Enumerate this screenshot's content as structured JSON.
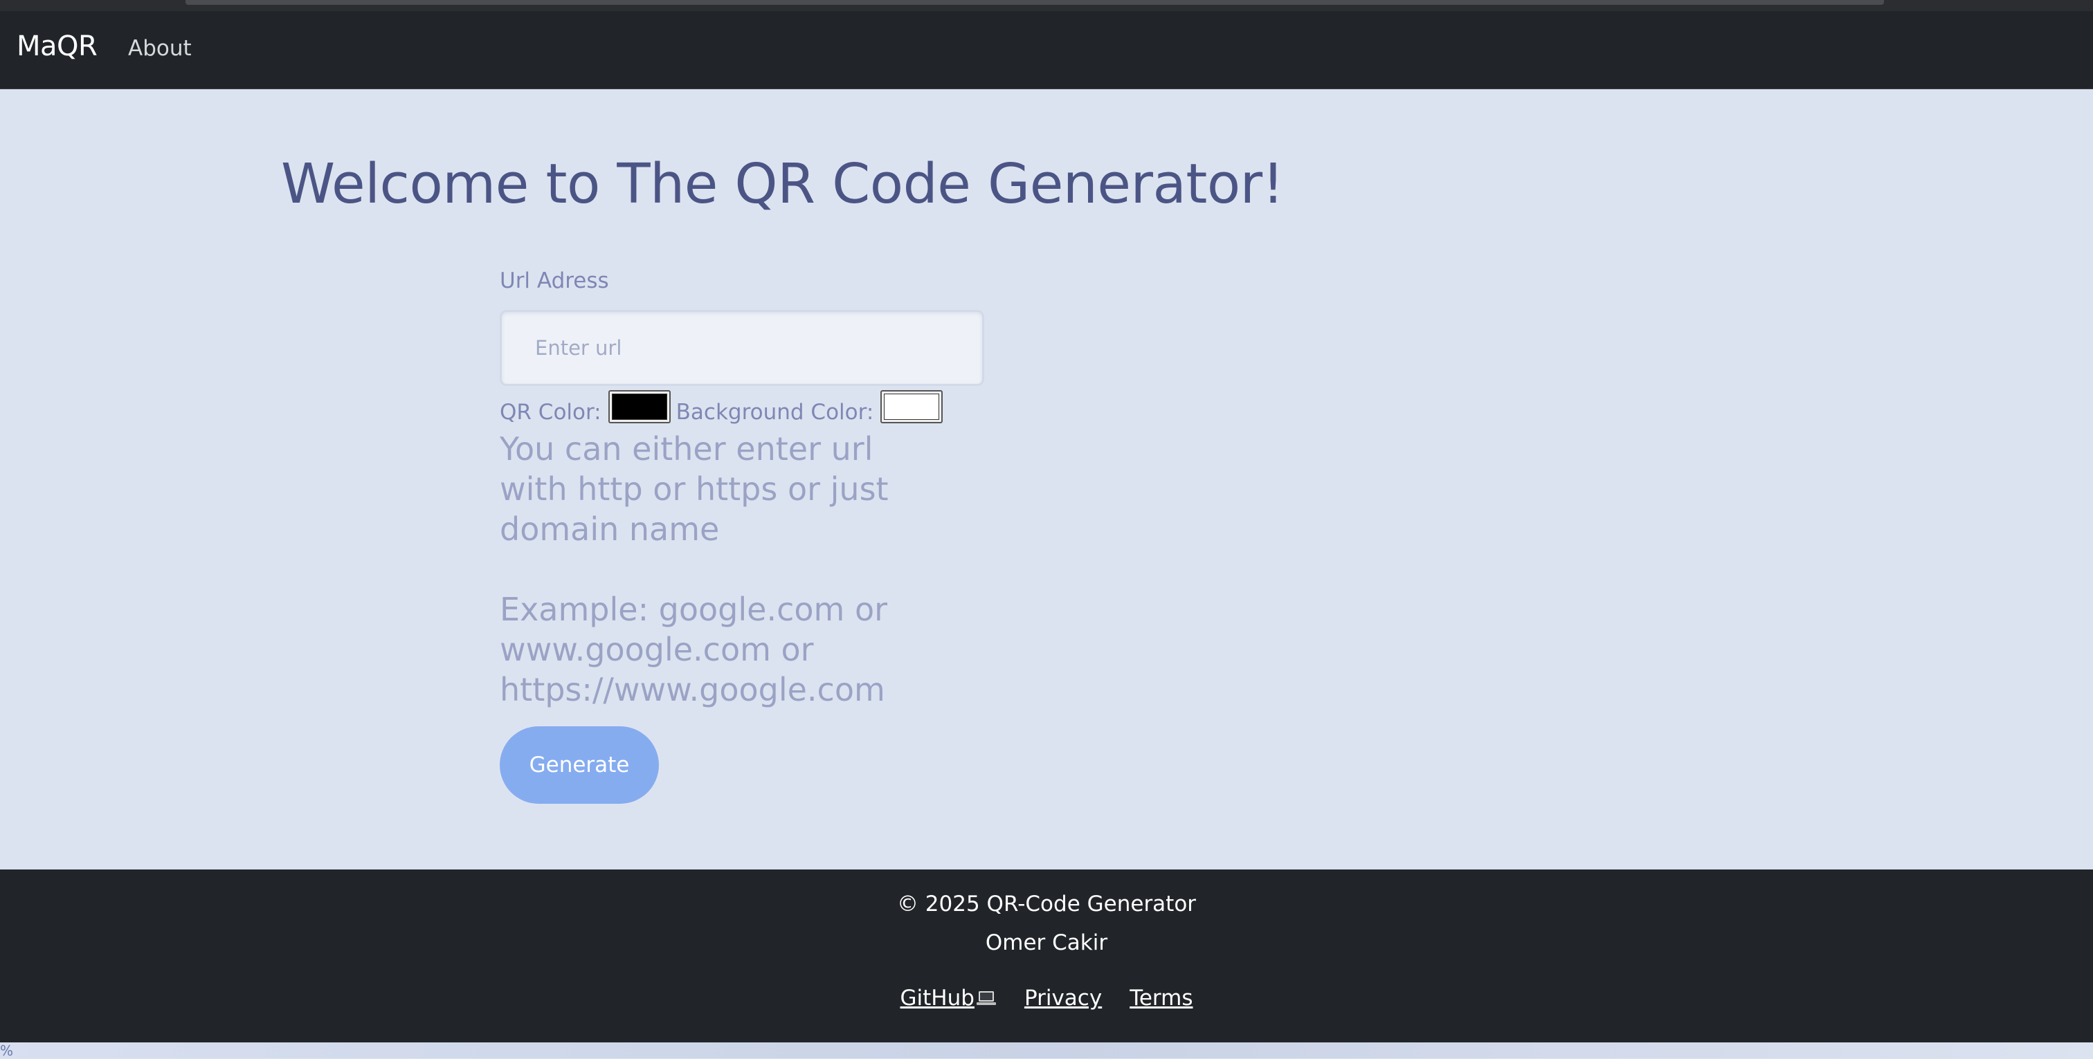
{
  "navbar": {
    "brand": "MaQR",
    "links": [
      "About"
    ]
  },
  "main": {
    "title": "Welcome to The QR Code Generator!",
    "url_label": "Url Adress",
    "url_value": "",
    "url_placeholder": "Enter url",
    "qr_color_label": "QR Color:",
    "qr_color": "#000000",
    "bg_color_label": "Background Color:",
    "bg_color": "#ffffff",
    "hint_line1": "You can either enter url with http or https or just domain name",
    "hint_line2": "Example: google.com or www.google.com or https://www.google.com",
    "generate_label": "Generate"
  },
  "footer": {
    "copyright": "© 2025 QR-Code Generator",
    "author": "Omer Cakir",
    "github_label": "GitHub",
    "privacy_label": "Privacy",
    "terms_label": "Terms"
  },
  "status": {
    "percent_text": "%"
  },
  "colors": {
    "navbar_bg": "#212529",
    "page_bg": "#dce3f0",
    "title_color": "#4b5585",
    "button_bg": "#86acf0"
  },
  "icons": {
    "github_suffix": "laptop-icon"
  }
}
